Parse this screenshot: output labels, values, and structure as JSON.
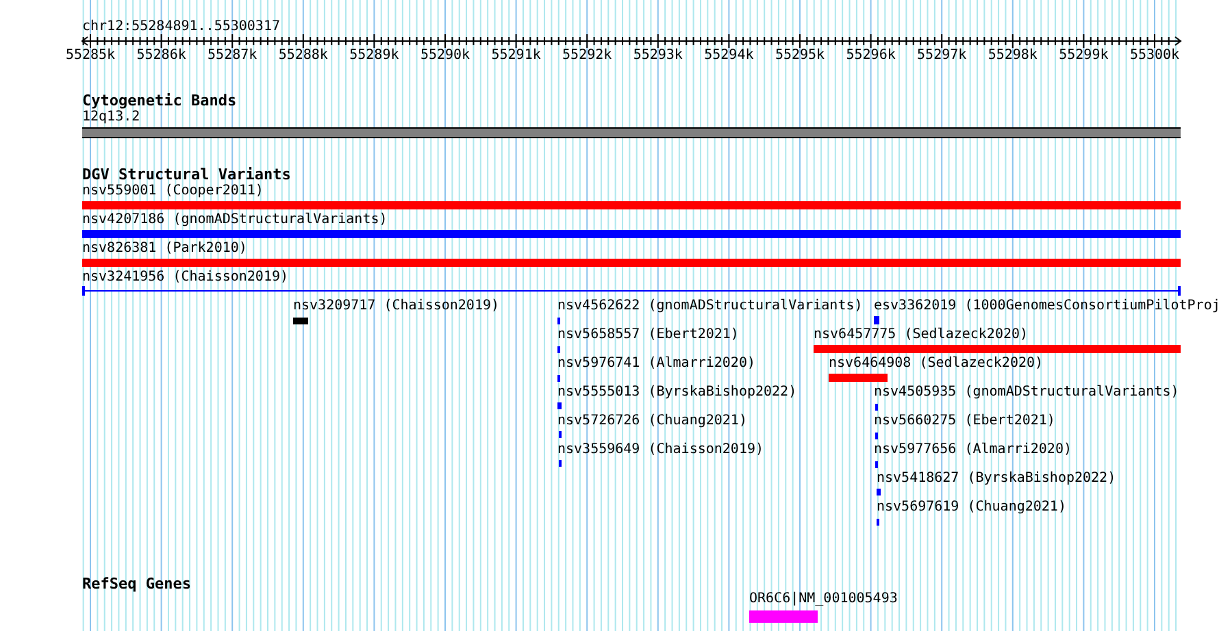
{
  "location": "chr12:55284891..55300317",
  "ruler_ticks": [
    "55285k",
    "55286k",
    "55287k",
    "55288k",
    "55289k",
    "55290k",
    "55291k",
    "55292k",
    "55293k",
    "55294k",
    "55295k",
    "55296k",
    "55297k",
    "55298k",
    "55299k",
    "55300k"
  ],
  "tracks": [
    {
      "title": "Cytogenetic Bands",
      "features": [
        {
          "label": "12q13.2",
          "kind": "band",
          "color": "#808080"
        }
      ]
    },
    {
      "title": "DGV Structural Variants",
      "features": [
        {
          "label": "nsv559001 (Cooper2011)",
          "kind": "bar",
          "color": "#ff0000"
        },
        {
          "label": "nsv4207186 (gnomADStructuralVariants)",
          "kind": "bar",
          "color": "#0000ff"
        },
        {
          "label": "nsv826381 (Park2010)",
          "kind": "bar",
          "color": "#ff0000"
        },
        {
          "label": "nsv3241956 (Chaisson2019)",
          "kind": "line",
          "color": "#0000ff"
        },
        {
          "label": "nsv3209717 (Chaisson2019)",
          "kind": "bar",
          "color": "#000000"
        },
        {
          "label": "nsv4562622 (gnomADStructuralVariants)",
          "kind": "bar",
          "color": "#0000ff"
        },
        {
          "label": "esv3362019 (1000GenomesConsortiumPilotProj",
          "kind": "bar",
          "color": "#0000ff"
        },
        {
          "label": "nsv5658557 (Ebert2021)",
          "kind": "bar",
          "color": "#0000ff"
        },
        {
          "label": "nsv6457775 (Sedlazeck2020)",
          "kind": "bar",
          "color": "#ff0000"
        },
        {
          "label": "nsv5976741 (Almarri2020)",
          "kind": "bar",
          "color": "#0000ff"
        },
        {
          "label": "nsv6464908 (Sedlazeck2020)",
          "kind": "bar",
          "color": "#ff0000"
        },
        {
          "label": "nsv5555013 (ByrskaBishop2022)",
          "kind": "bar",
          "color": "#0000ff"
        },
        {
          "label": "nsv4505935 (gnomADStructuralVariants)",
          "kind": "bar",
          "color": "#0000ff"
        },
        {
          "label": "nsv5726726 (Chuang2021)",
          "kind": "bar",
          "color": "#0000ff"
        },
        {
          "label": "nsv5660275 (Ebert2021)",
          "kind": "bar",
          "color": "#0000ff"
        },
        {
          "label": "nsv3559649 (Chaisson2019)",
          "kind": "bar",
          "color": "#0000ff"
        },
        {
          "label": "nsv5977656 (Almarri2020)",
          "kind": "bar",
          "color": "#0000ff"
        },
        {
          "label": "nsv5418627 (ByrskaBishop2022)",
          "kind": "bar",
          "color": "#0000ff"
        },
        {
          "label": "nsv5697619 (Chuang2021)",
          "kind": "bar",
          "color": "#0000ff"
        }
      ]
    },
    {
      "title": "RefSeq Genes",
      "features": [
        {
          "label": "OR6C6|NM_001005493",
          "kind": "gene",
          "color": "#ff00ff"
        }
      ]
    }
  ]
}
